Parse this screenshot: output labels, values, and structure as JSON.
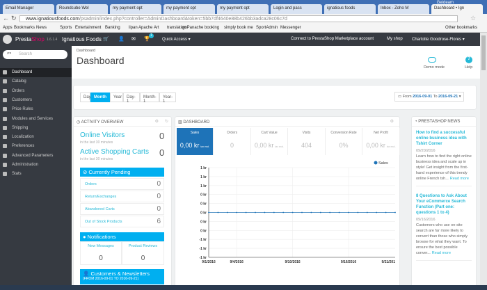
{
  "browser": {
    "tabs": [
      "Email Manager",
      "Roundcube Wel",
      "my payment opt",
      "my payment opt",
      "my payment opt",
      "Login and pass",
      "ignatious foods",
      "Inbox - Zoho M",
      "Dashboard • Ign"
    ],
    "window_user": "Geideam",
    "url_host": "www.ignatiousfoods.com",
    "url_path": "/psadmin/index.php?controller=AdminDashboard&token=5bb7df4640e88b426bb3adca28c06c7d",
    "bookmarks": [
      "Apps",
      "Bookmarks",
      "News",
      "Sports",
      "Entertainment",
      "Banking",
      "lipan Apache",
      "Art",
      "translation",
      "goPanache booking",
      "simply book me",
      "SportAdmin",
      "Messenger",
      "Other bookmarks"
    ]
  },
  "header": {
    "brand_a": "Presta",
    "brand_b": "Shop",
    "version": "1.6.1.4",
    "shop": "Ignatious Foods",
    "badge": "1",
    "quick_access": "Quick Access ▾",
    "connect": "Connect to PrestaShop Marketplace account",
    "my_shop": "My shop",
    "user": "Charlotte Goodrose-Flores ▾"
  },
  "sidebar": {
    "search_placeholder": "Search",
    "items": [
      "Dashboard",
      "Catalog",
      "Orders",
      "Customers",
      "Price Rules",
      "Modules and Services",
      "Shipping",
      "Localization",
      "Preferences",
      "Advanced Parameters",
      "Administration",
      "Stats"
    ]
  },
  "page": {
    "breadcrumb": "Dashboard",
    "title": "Dashboard",
    "demo_mode": "Demo mode",
    "help": "Help"
  },
  "filter": {
    "periods": [
      "Day",
      "Month",
      "Year",
      "Day-1",
      "Month-1",
      "Year-1"
    ],
    "active": "Month",
    "from_label": "From",
    "from": "2016-09-01",
    "to_label": "To",
    "to": "2016-09-21"
  },
  "activity": {
    "title": "ACTIVITY OVERVIEW",
    "online_visitors": "Online Visitors",
    "online_value": "0",
    "sub": "in the last 30 minutes",
    "active_carts": "Active Shopping Carts",
    "carts_value": "0",
    "pending_title": "Currently Pending",
    "pending": [
      {
        "label": "Orders",
        "value": "0"
      },
      {
        "label": "Return/Exchanges",
        "value": "0"
      },
      {
        "label": "Abandoned Carts",
        "value": "0"
      },
      {
        "label": "Out of Stock Products",
        "value": "6"
      }
    ],
    "notifications_title": "Notifications",
    "new_messages": "New Messages",
    "new_messages_value": "0",
    "product_reviews": "Product Reviews",
    "product_reviews_value": "0",
    "customers_title": "Customers & Newsletters",
    "customers_range": "(FROM 2016-09-01 TO 2016-09-21)"
  },
  "dashboard": {
    "title": "DASHBOARD",
    "kpis": [
      {
        "label": "Sales",
        "value": "0,00 kr",
        "suffix": "tax excl."
      },
      {
        "label": "Orders",
        "value": "0",
        "suffix": ""
      },
      {
        "label": "Cart Value",
        "value": "0,00 kr",
        "suffix": "tax excl."
      },
      {
        "label": "Visits",
        "value": "404",
        "suffix": ""
      },
      {
        "label": "Conversion Rate",
        "value": "0%",
        "suffix": ""
      },
      {
        "label": "Net Profit",
        "value": "0,00 kr",
        "suffix": "tax excl."
      }
    ]
  },
  "chart_data": {
    "type": "line",
    "legend": "top-right",
    "series": [
      {
        "name": "Sales",
        "color": "#1e73b8",
        "values": [
          0,
          0,
          0,
          0,
          0,
          0,
          0,
          0,
          0,
          0,
          0,
          0,
          0,
          0,
          0,
          0,
          0,
          0,
          0,
          0,
          0
        ]
      }
    ],
    "x": [
      "9/1/2016",
      "9/2/2016",
      "9/3/2016",
      "9/4/2016",
      "9/5/2016",
      "9/6/2016",
      "9/7/2016",
      "9/8/2016",
      "9/9/2016",
      "9/10/2016",
      "9/11/2016",
      "9/12/2016",
      "9/13/2016",
      "9/14/2016",
      "9/15/2016",
      "9/16/2016",
      "9/17/2016",
      "9/18/2016",
      "9/19/2016",
      "9/20/2016",
      "9/21/2016"
    ],
    "xtick_labels": [
      "9/1/2016",
      "9/4/2016",
      "9/10/2016",
      "9/16/2016",
      "9/21/201"
    ],
    "ytick_labels": [
      "1 kr",
      "1 kr",
      "1 kr",
      "0 kr",
      "0 kr",
      "0 kr",
      "0 kr",
      "0 kr",
      "-1 kr",
      "-1 kr",
      "-1 kr"
    ],
    "ylim": [
      -1,
      1
    ],
    "grid": true
  },
  "news": {
    "title": "PRESTASHOP NEWS",
    "items": [
      {
        "title": "How to find a successful online business idea with Tshirt Corner",
        "date": "09/20/2016",
        "text": "Learn how to find the right online business idea and scale up in style! Get insight from the first-hand experience of this trendy online French tsh...",
        "more": "Read more"
      },
      {
        "title": "8 Questions to Ask About Your eCommerce Search Function (Part one: questions 1 to 4)",
        "date": "09/16/2016",
        "text": "Customers who use on-site search are far more likely to convert than those who simply browse for what they want. To ensure the best possible conver...",
        "more": "Read more"
      }
    ]
  }
}
